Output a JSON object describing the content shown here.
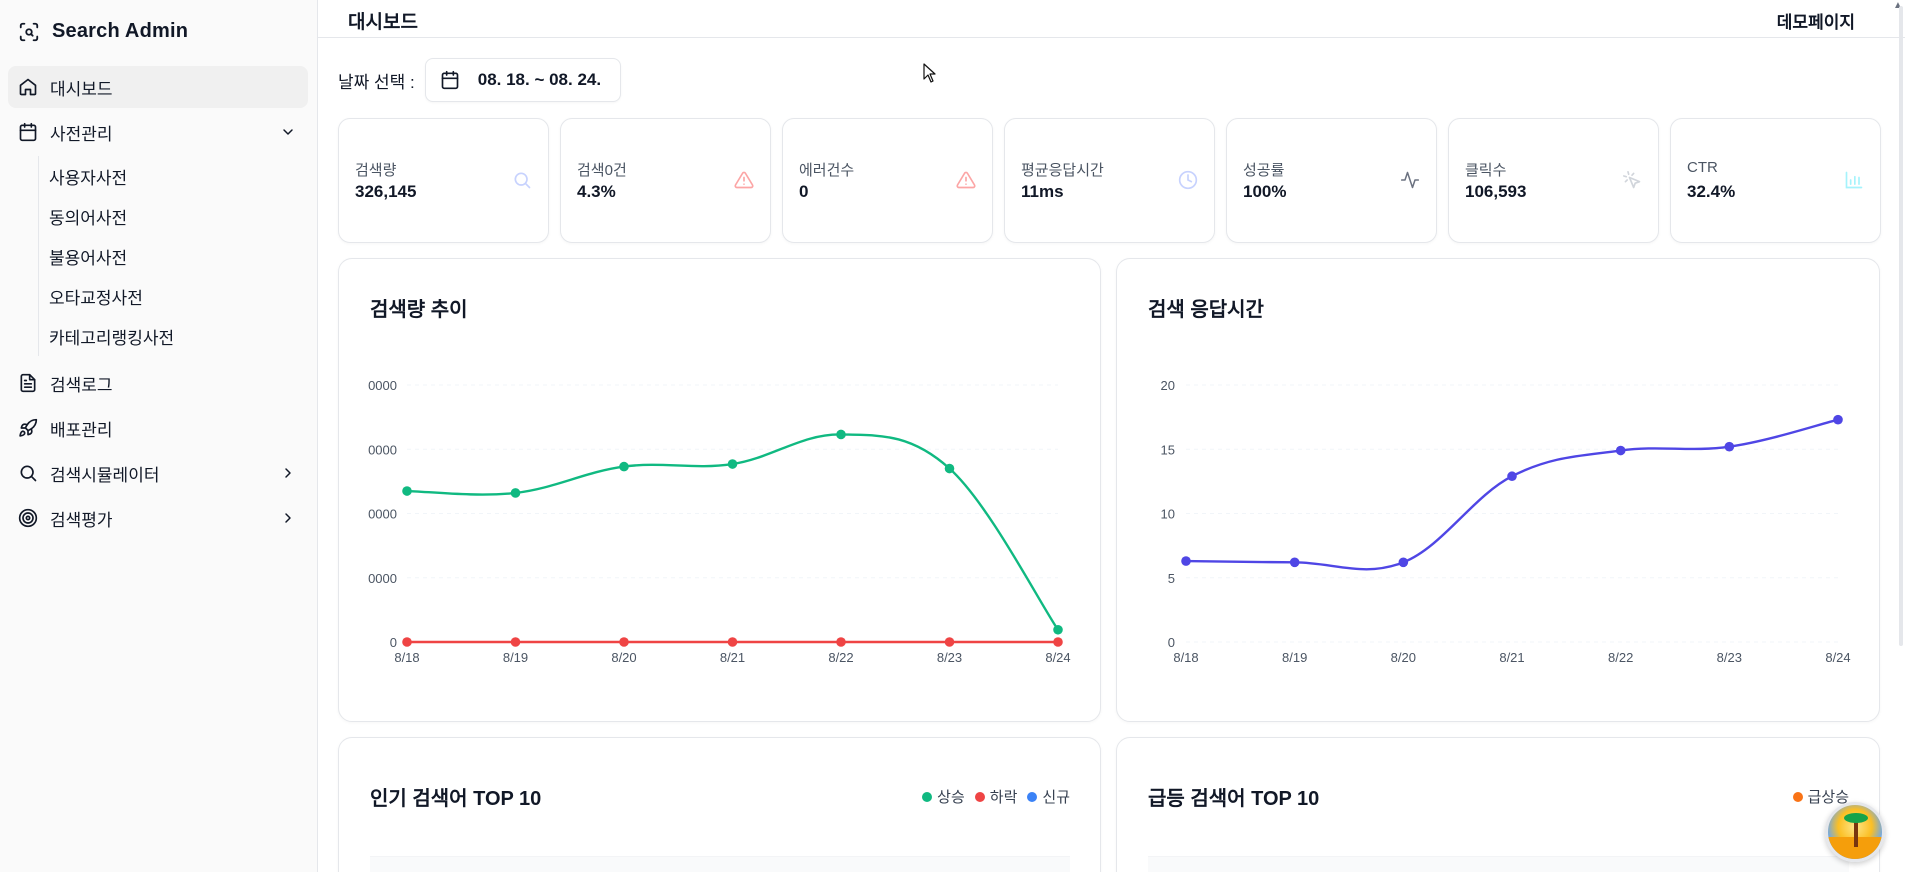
{
  "app": {
    "title": "Search Admin"
  },
  "sidebar": {
    "items": [
      {
        "label": "대시보드",
        "icon": "home-icon",
        "active": true
      },
      {
        "label": "사전관리",
        "icon": "calendar-icon",
        "expanded": true,
        "children": [
          "사용자사전",
          "동의어사전",
          "불용어사전",
          "오타교정사전",
          "카테고리랭킹사전"
        ]
      },
      {
        "label": "검색로그",
        "icon": "file-text-icon"
      },
      {
        "label": "배포관리",
        "icon": "rocket-icon"
      },
      {
        "label": "검색시뮬레이터",
        "icon": "search-icon",
        "has_children": true
      },
      {
        "label": "검색평가",
        "icon": "target-icon",
        "has_children": true
      }
    ]
  },
  "header": {
    "title": "대시보드",
    "demo": "데모페이지"
  },
  "date_filter": {
    "label": "날짜 선택 :",
    "value": "08. 18. ~ 08. 24."
  },
  "stats": [
    {
      "label": "검색량",
      "value": "326,145",
      "icon": "search-icon",
      "color": "#c7d2fe"
    },
    {
      "label": "검색0건",
      "value": "4.3%",
      "icon": "alert-triangle-icon",
      "color": "#fca5a5"
    },
    {
      "label": "에러건수",
      "value": "0",
      "icon": "alert-triangle-icon",
      "color": "#fca5a5"
    },
    {
      "label": "평균응답시간",
      "value": "11ms",
      "icon": "clock-icon",
      "color": "#c7d2fe"
    },
    {
      "label": "성공률",
      "value": "100%",
      "icon": "activity-icon",
      "color": "#6b7280"
    },
    {
      "label": "클릭수",
      "value": "106,593",
      "icon": "pointer-click-icon",
      "color": "#d1d5db"
    },
    {
      "label": "CTR",
      "value": "32.4%",
      "icon": "bar-chart-icon",
      "color": "#a5f3fc"
    }
  ],
  "chart_data": [
    {
      "type": "line",
      "title": "검색량 추이",
      "categories": [
        "8/18",
        "8/19",
        "8/20",
        "8/21",
        "8/22",
        "8/23",
        "8/24"
      ],
      "ytick_labels": [
        "0",
        "0000",
        "0000",
        "0000",
        "0000"
      ],
      "yticks": [
        0,
        10000,
        20000,
        30000,
        40000
      ],
      "ylim": [
        0,
        40000
      ],
      "series": [
        {
          "values": [
            23500,
            23200,
            27300,
            27700,
            32300,
            27000,
            1900
          ],
          "color": "#10b981"
        },
        {
          "values": [
            0,
            0,
            0,
            0,
            0,
            0,
            0
          ],
          "color": "#ef4444"
        }
      ],
      "grid": true
    },
    {
      "type": "line",
      "title": "검색 응답시간",
      "categories": [
        "8/18",
        "8/19",
        "8/20",
        "8/21",
        "8/22",
        "8/23",
        "8/24"
      ],
      "ytick_labels": [
        "0",
        "5",
        "10",
        "15",
        "20"
      ],
      "yticks": [
        0,
        5,
        10,
        15,
        20
      ],
      "ylim": [
        0,
        20
      ],
      "series": [
        {
          "values": [
            6.3,
            6.2,
            6.2,
            12.9,
            14.9,
            15.2,
            17.3
          ],
          "color": "#4f46e5"
        }
      ],
      "grid": true
    }
  ],
  "popular": {
    "title": "인기 검색어 TOP 10",
    "legend": [
      {
        "label": "상승",
        "color": "#10b981"
      },
      {
        "label": "하락",
        "color": "#ef4444"
      },
      {
        "label": "신규",
        "color": "#3b82f6"
      }
    ]
  },
  "rising": {
    "title": "급등 검색어 TOP 10",
    "legend": [
      {
        "label": "급상승",
        "color": "#f97316"
      }
    ]
  }
}
